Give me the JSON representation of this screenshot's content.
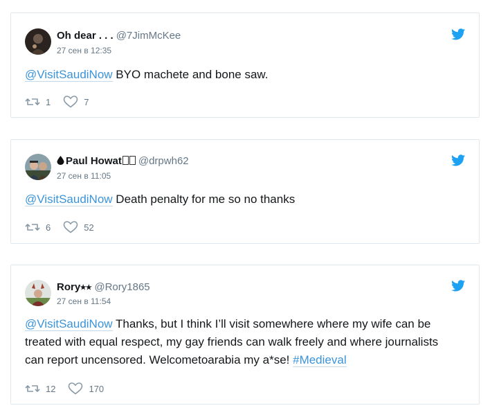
{
  "tweets": [
    {
      "name": "Oh dear . . .",
      "handle": "@7JimMcKee",
      "date": "27 сен в 12:35",
      "mention": "@VisitSaudiNow",
      "text": " BYO machete and bone saw.",
      "retweets": "1",
      "likes": "7"
    },
    {
      "name": "Paul Howat",
      "handle": "@drpwh62",
      "date": "27 сен в 11:05",
      "mention": "@VisitSaudiNow",
      "text": " Death penalty for me so no thanks",
      "retweets": "6",
      "likes": "52"
    },
    {
      "name": "Rory⭑⭑",
      "handle": "@Rory1865",
      "date": "27 сен в 11:54",
      "mention": "@VisitSaudiNow",
      "text": " Thanks, but I think I’ll visit somewhere where my wife can be treated with equal respect, my gay friends can walk freely and where journalists can report uncensored. Welcometoarabia my a*se! ",
      "hashtag": "#Medieval",
      "retweets": "12",
      "likes": "170"
    }
  ],
  "colors": {
    "link": "#3b94d9",
    "twitter_blue": "#1da1f2",
    "muted": "#657786",
    "border": "#e1e8ed"
  },
  "icons": {
    "brand": "twitter-bird-icon",
    "retweet": "retweet-icon",
    "like": "heart-icon"
  }
}
